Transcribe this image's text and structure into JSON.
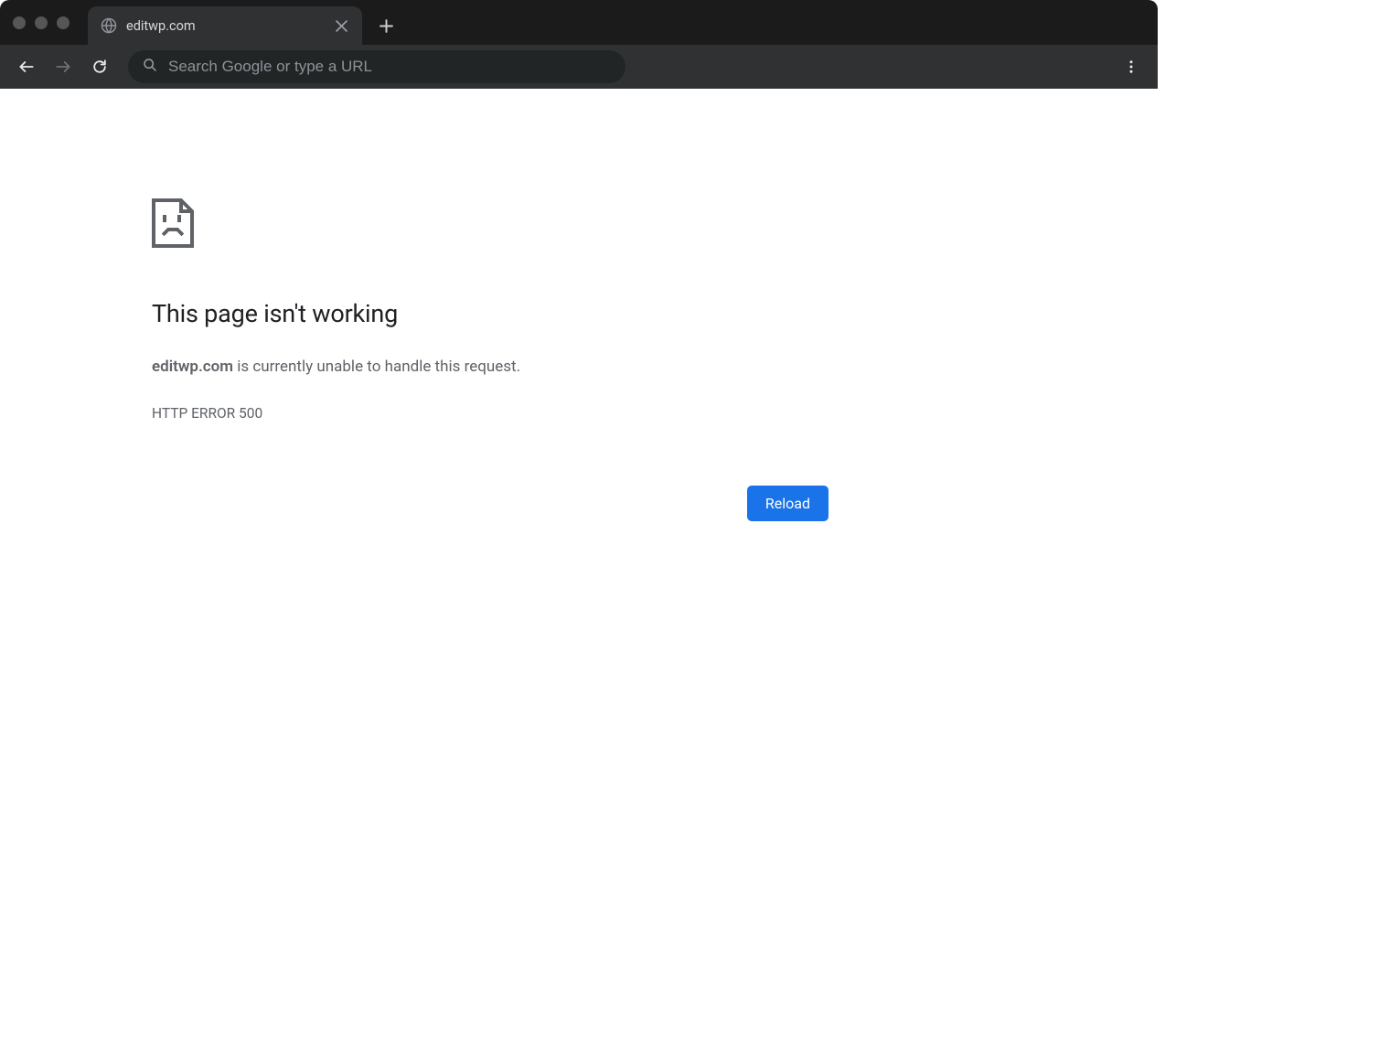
{
  "browser": {
    "tab": {
      "title": "editwp.com"
    },
    "omnibox": {
      "placeholder": "Search Google or type a URL",
      "value": ""
    }
  },
  "error": {
    "title": "This page isn't working",
    "domain": "editwp.com",
    "message_suffix": " is currently unable to handle this request.",
    "code": "HTTP ERROR 500",
    "reload_label": "Reload"
  }
}
